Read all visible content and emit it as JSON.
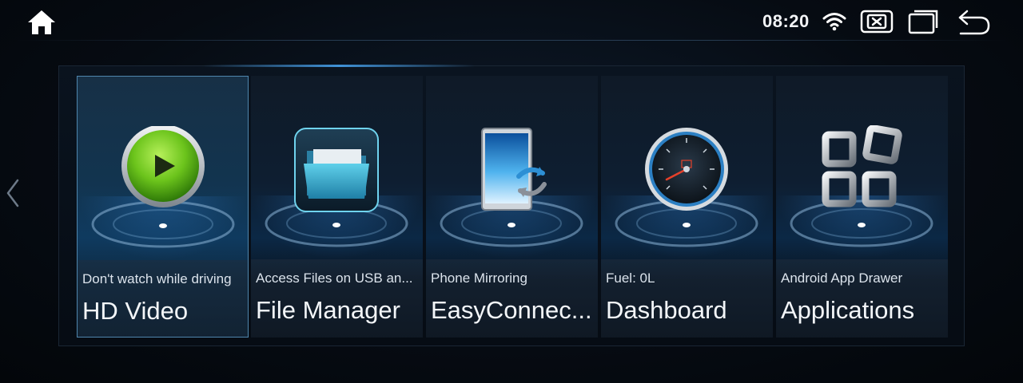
{
  "statusbar": {
    "time": "08:20",
    "icons": [
      "home-icon",
      "wifi-icon",
      "close-app-icon",
      "recent-apps-icon",
      "back-icon"
    ]
  },
  "apps": [
    {
      "subtitle": "Don't watch while driving",
      "title": "HD Video",
      "icon": "play-icon",
      "selected": true
    },
    {
      "subtitle": "Access Files on USB an...",
      "title": "File Manager",
      "icon": "folder-icon",
      "selected": false
    },
    {
      "subtitle": "Phone Mirroring",
      "title": "EasyConnec...",
      "icon": "phone-mirror-icon",
      "selected": false
    },
    {
      "subtitle": "Fuel: 0L",
      "title": "Dashboard",
      "icon": "speedometer-icon",
      "selected": false
    },
    {
      "subtitle": "Android App Drawer",
      "title": "Applications",
      "icon": "app-grid-icon",
      "selected": false
    }
  ],
  "colors": {
    "accent": "#4f86ad",
    "play_green": "#6cc41c",
    "folder_teal": "#3fa9c8"
  }
}
